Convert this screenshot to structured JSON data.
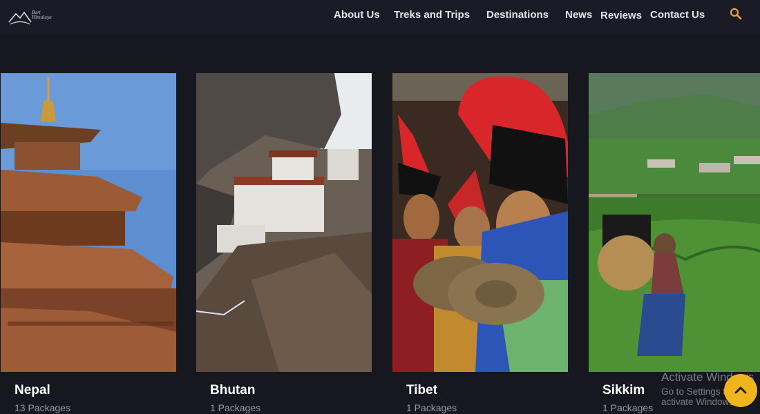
{
  "header": {
    "logo_icon": "mountain-logo",
    "logo_text_line1": "Bari",
    "logo_text_line2": "Himalaya",
    "nav": [
      {
        "label": "About Us"
      },
      {
        "label": "Treks and Trips"
      },
      {
        "label": "Destinations"
      },
      {
        "label": "News"
      },
      {
        "label": "Reviews"
      },
      {
        "label": "Contact Us"
      }
    ],
    "search_icon": "search-icon",
    "accent_color": "#e6a821"
  },
  "destinations": [
    {
      "name": "Nepal",
      "packages": "13 Packages",
      "image": "pagoda-temple"
    },
    {
      "name": "Bhutan",
      "packages": "1 Packages",
      "image": "cliffside-monastery"
    },
    {
      "name": "Tibet",
      "packages": "1 Packages",
      "image": "monks-ceremony"
    },
    {
      "name": "Sikkim",
      "packages": "1 Packages",
      "image": "tea-garden-picker"
    }
  ],
  "watermark": {
    "line1": "Activate Windows",
    "line2": "Go to Settings to activate Windows."
  },
  "scroll_top": {
    "icon": "chevron-up-icon",
    "color": "#f0b41c"
  }
}
